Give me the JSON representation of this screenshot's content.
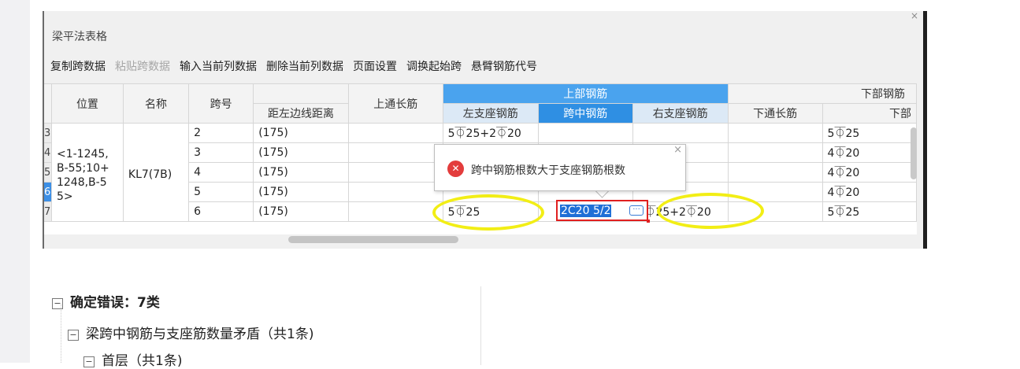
{
  "panel": {
    "close_glyph": "×",
    "title": "梁平法表格",
    "toolbar": [
      {
        "label": "复制跨数据",
        "enabled": true
      },
      {
        "label": "粘贴跨数据",
        "enabled": false
      },
      {
        "label": "输入当前列数据",
        "enabled": true
      },
      {
        "label": "删除当前列数据",
        "enabled": true
      },
      {
        "label": "页面设置",
        "enabled": true
      },
      {
        "label": "调换起始跨",
        "enabled": true
      },
      {
        "label": "悬臂钢筋代号",
        "enabled": true
      }
    ]
  },
  "grid": {
    "headers": {
      "position": "位置",
      "name": "名称",
      "span_no": "跨号",
      "distance": "距左边线距离",
      "top_through": "上通长筋",
      "top_group": "上部钢筋",
      "left_support": "左支座钢筋",
      "mid_span": "跨中钢筋",
      "right_support": "右支座钢筋",
      "bottom_group": "下部钢筋",
      "bottom_through": "下通长筋",
      "bottom_next": "下部"
    },
    "merged": {
      "position": "<1-1245, B-55;10+ 1248,B-5 5>",
      "name": "KL7(7B)"
    },
    "rows": [
      {
        "rn": "3",
        "span": "2",
        "dist": "(175)",
        "left": "5⏁25+2⏁20",
        "mid": "",
        "right": "",
        "bottom": "5⏁25"
      },
      {
        "rn": "4",
        "span": "3",
        "dist": "(175)",
        "left": "",
        "mid": "",
        "right": "",
        "bottom": "4⏁20"
      },
      {
        "rn": "5",
        "span": "4",
        "dist": "(175)",
        "left": "",
        "mid": "",
        "right": "",
        "bottom": "4⏁20"
      },
      {
        "rn": "6",
        "span": "5",
        "dist": "(175)",
        "left": "",
        "mid": "",
        "right": "",
        "bottom": "4⏁20"
      },
      {
        "rn": "7",
        "span": "6",
        "dist": "(175)",
        "left": "5⏁25",
        "mid": "",
        "right": "5⏁25+2⏁20",
        "bottom": "5⏁25"
      }
    ],
    "editing_value": "2C20 5/2",
    "more_glyph": "···"
  },
  "tooltip": {
    "icon_glyph": "✕",
    "message": "跨中钢筋根数大于支座钢筋根数",
    "close_glyph": "×"
  },
  "highlight_color": "#f2ee15",
  "tree": {
    "nodes": [
      {
        "label": "确定错误：7类",
        "box": "−"
      },
      {
        "label": "梁跨中钢筋与支座筋数量矛盾（共1条)",
        "box": "−"
      },
      {
        "label": "首层（共1条)",
        "box": "−"
      }
    ]
  }
}
